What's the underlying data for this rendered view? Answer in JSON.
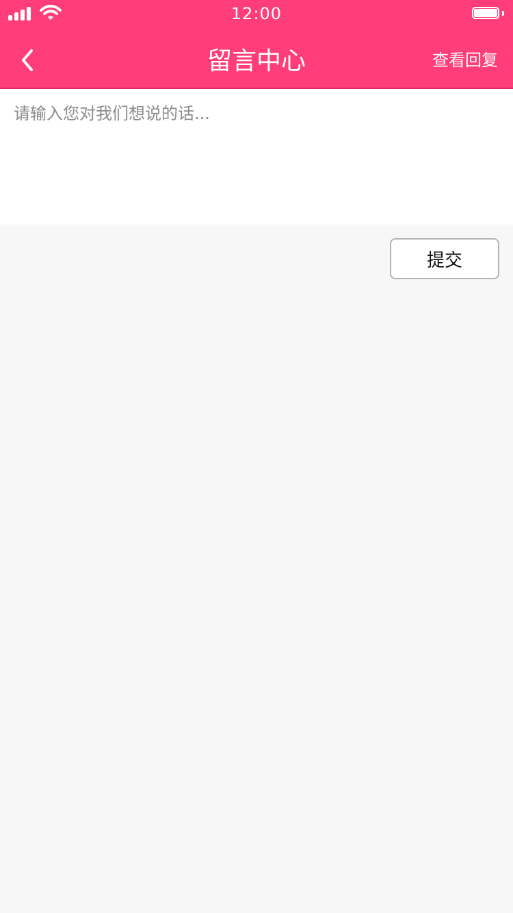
{
  "status_bar": {
    "time": "12:00"
  },
  "nav": {
    "title": "留言中心",
    "right_action": "查看回复",
    "back_icon": "chevron-left-icon"
  },
  "form": {
    "placeholder": "请输入您对我们想说的话...",
    "value": "",
    "submit_label": "提交"
  },
  "colors": {
    "brand": "#ff3d7a",
    "background": "#f7f7f7",
    "input_bg": "#ffffff",
    "placeholder": "#8b8b8b",
    "button_border": "#b3b3b3"
  }
}
